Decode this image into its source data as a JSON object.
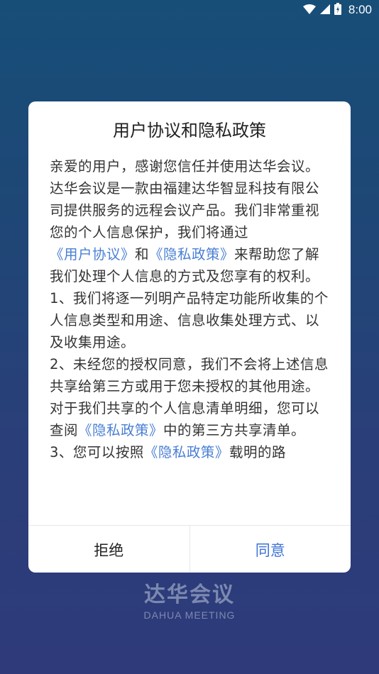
{
  "status_bar": {
    "time": "8:00",
    "icons": [
      "wifi-icon",
      "signal-icon",
      "battery-icon"
    ]
  },
  "dialog": {
    "title": "用户协议和隐私政策",
    "paragraphs": {
      "p1": "亲爱的用户，感谢您信任并使用达华会议。",
      "p2_a": "达华会议是一款由福建达华智显科技有限公司提供服务的远程会议产品。我们非常重视您的个人信息保护，我们将通过",
      "p2_link1": "《用户协议》",
      "p2_b": "和",
      "p2_link2": "《隐私政策》",
      "p2_c": "来帮助您了解我们处理个人信息的方式及您享有的权利。",
      "p3": "1、我们将逐一列明产品特定功能所收集的个人信息类型和用途、信息收集处理方式、以及收集用途。",
      "p4_a": "2、未经您的授权同意，我们不会将上述信息共享给第三方或用于您未授权的其他用途。对于我们共享的个人信息清单明细，您可以查阅",
      "p4_link": "《隐私政策》",
      "p4_b": "中的第三方共享清单。",
      "p5_a": "3、您可以按照",
      "p5_link": "《隐私政策》",
      "p5_b": "载明的路"
    },
    "buttons": {
      "reject": "拒绝",
      "agree": "同意"
    }
  },
  "logo": {
    "cn": "达华会议",
    "en": "DAHUA MEETING"
  },
  "colors": {
    "link": "#4a7fd4",
    "agree": "#3d74d6",
    "background_top": "#174e78",
    "background_bottom": "#2e3a7a"
  }
}
